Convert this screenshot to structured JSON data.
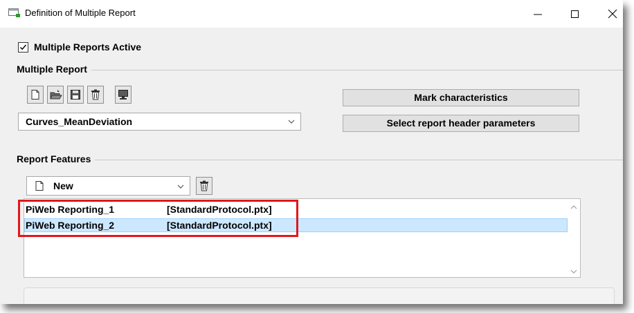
{
  "window": {
    "title": "Definition of Multiple Report",
    "icons": {
      "app": "report-window-icon",
      "minimize": "minimize-icon",
      "maximize": "maximize-icon",
      "close": "close-icon"
    }
  },
  "multiple_reports_active": {
    "label": "Multiple Reports Active",
    "checked": true
  },
  "multiple_report": {
    "group_label": "Multiple Report",
    "toolbar_icons": [
      "new-document-icon",
      "open-folder-icon",
      "save-icon",
      "delete-icon",
      "monitor-icon"
    ],
    "selected_report": "Curves_MeanDeviation",
    "mark_characteristics_label": "Mark characteristics",
    "select_header_params_label": "Select report header parameters"
  },
  "report_features": {
    "group_label": "Report Features",
    "new_combo_value": "New",
    "items": [
      {
        "name": "PiWeb Reporting_1",
        "protocol": "[StandardProtocol.ptx]",
        "selected": false
      },
      {
        "name": "PiWeb Reporting_2",
        "protocol": "[StandardProtocol.ptx]",
        "selected": true
      }
    ]
  },
  "colors": {
    "window_bg": "#f0f0f0",
    "selection_bg": "#cce8ff",
    "highlight_border": "#e3161b"
  }
}
